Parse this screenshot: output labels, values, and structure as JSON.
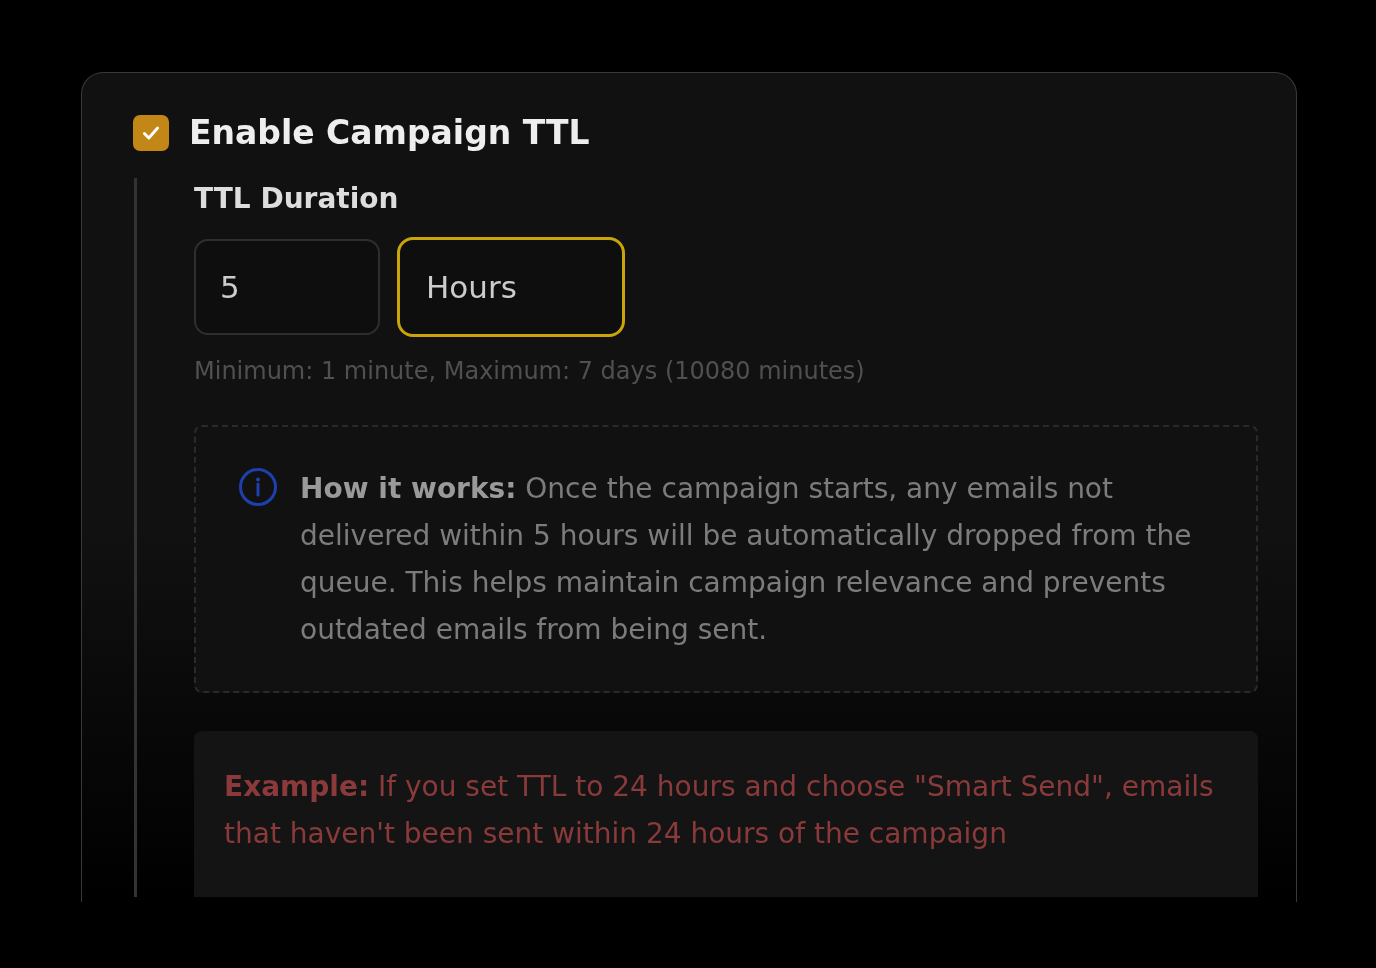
{
  "checkbox": {
    "label": "Enable Campaign TTL",
    "checked": true
  },
  "duration": {
    "label": "TTL Duration",
    "value": "5",
    "unit": "Hours",
    "unit_focused": true
  },
  "hint": "Minimum: 1 minute, Maximum: 7 days (10080 minutes)",
  "info": {
    "text": "**How it works:** Once the campaign starts, any emails not delivered within 5 hours will be automatically dropped from the queue. This helps maintain campaign relevance and prevents outdated emails from being sent."
  },
  "example": {
    "text": "**Example:** If you set TTL to 24 hours and choose \"Smart Send\", emails that haven't been sent within 24 hours of the campaign"
  }
}
